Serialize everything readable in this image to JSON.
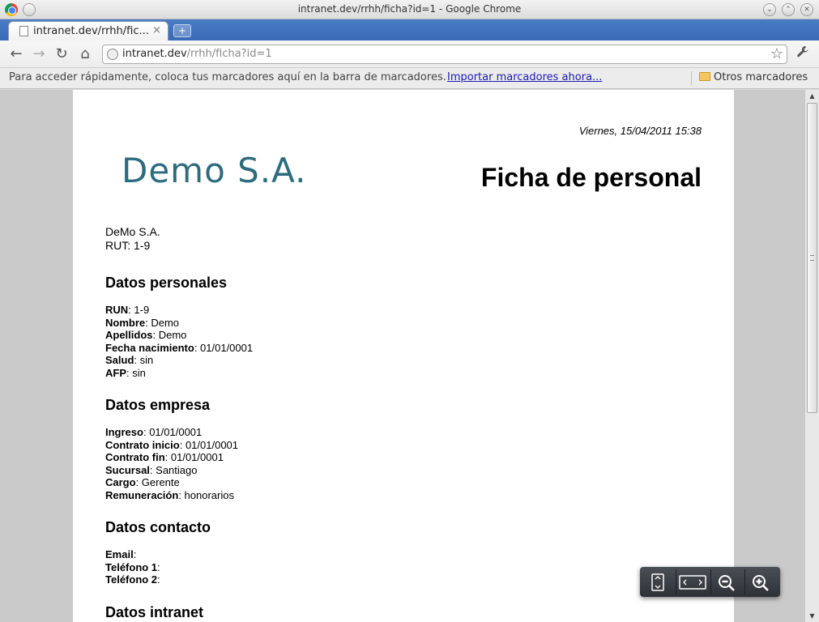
{
  "window": {
    "title": "intranet.dev/rrhh/ficha?id=1 - Google Chrome",
    "controls": [
      "⌄",
      "⌃",
      "✕"
    ]
  },
  "tab": {
    "label": "intranet.dev/rrhh/fic...",
    "close": "×",
    "new_tab": "+"
  },
  "toolbar": {
    "back": "←",
    "forward": "→",
    "reload": "↻",
    "home": "⌂",
    "url_host": "intranet.dev",
    "url_path": "/rrhh/ficha?id=1",
    "star": "☆",
    "wrench": "🔧"
  },
  "bookmarks": {
    "hint": "Para acceder rápidamente, coloca tus marcadores aquí en la barra de marcadores.",
    "import_link": "Importar marcadores ahora...",
    "other": "Otros marcadores"
  },
  "document": {
    "date": "Viernes, 15/04/2011 15:38",
    "logo": "Demo S.A.",
    "title": "Ficha de personal",
    "company_name": "DeMo S.A.",
    "company_rut": "RUT: 1-9",
    "sections": {
      "personal": {
        "title": "Datos personales",
        "fields": [
          {
            "label": "RUN",
            "value": ": 1-9"
          },
          {
            "label": "Nombre",
            "value": ": Demo"
          },
          {
            "label": "Apellidos",
            "value": ": Demo"
          },
          {
            "label": "Fecha nacimiento",
            "value": ": 01/01/0001"
          },
          {
            "label": "Salud",
            "value": ": sin"
          },
          {
            "label": "AFP",
            "value": ": sin"
          }
        ]
      },
      "empresa": {
        "title": "Datos empresa",
        "fields": [
          {
            "label": "Ingreso",
            "value": ": 01/01/0001"
          },
          {
            "label": "Contrato inicio",
            "value": ": 01/01/0001"
          },
          {
            "label": "Contrato fin",
            "value": ": 01/01/0001"
          },
          {
            "label": "Sucursal",
            "value": ": Santiago"
          },
          {
            "label": "Cargo",
            "value": ": Gerente"
          },
          {
            "label": "Remuneración",
            "value": ": honorarios"
          }
        ]
      },
      "contacto": {
        "title": "Datos contacto",
        "fields": [
          {
            "label": "Email",
            "value": ":"
          },
          {
            "label": "Teléfono 1",
            "value": ":"
          },
          {
            "label": "Teléfono 2",
            "value": ":"
          }
        ]
      },
      "intranet": {
        "title": "Datos intranet"
      }
    }
  },
  "colors": {
    "logo": "#2d6b7f",
    "tabstrip": "#3a69b5",
    "link": "#1a1ab0"
  }
}
